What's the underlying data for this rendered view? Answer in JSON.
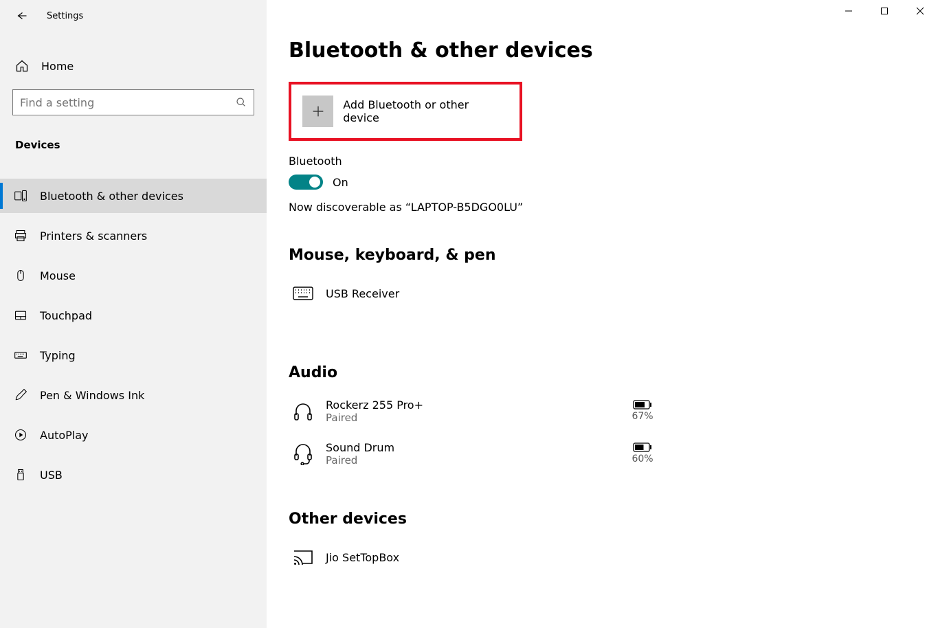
{
  "app": {
    "title": "Settings"
  },
  "sidebar": {
    "home_label": "Home",
    "search_placeholder": "Find a setting",
    "section_title": "Devices",
    "items": [
      {
        "label": "Bluetooth & other devices"
      },
      {
        "label": "Printers & scanners"
      },
      {
        "label": "Mouse"
      },
      {
        "label": "Touchpad"
      },
      {
        "label": "Typing"
      },
      {
        "label": "Pen & Windows Ink"
      },
      {
        "label": "AutoPlay"
      },
      {
        "label": "USB"
      }
    ]
  },
  "main": {
    "page_title": "Bluetooth & other devices",
    "add_device_label": "Add Bluetooth or other device",
    "bluetooth": {
      "label": "Bluetooth",
      "state_label": "On",
      "discoverable_text": "Now discoverable as “LAPTOP-B5DGO0LU”"
    },
    "groups": {
      "mouse": {
        "title": "Mouse, keyboard, & pen",
        "devices": [
          {
            "name": "USB Receiver"
          }
        ]
      },
      "audio": {
        "title": "Audio",
        "devices": [
          {
            "name": "Rockerz 255 Pro+",
            "status": "Paired",
            "battery": "67%"
          },
          {
            "name": "Sound Drum",
            "status": "Paired",
            "battery": "60%"
          }
        ]
      },
      "other": {
        "title": "Other devices",
        "devices": [
          {
            "name": "Jio SetTopBox"
          }
        ]
      }
    }
  }
}
